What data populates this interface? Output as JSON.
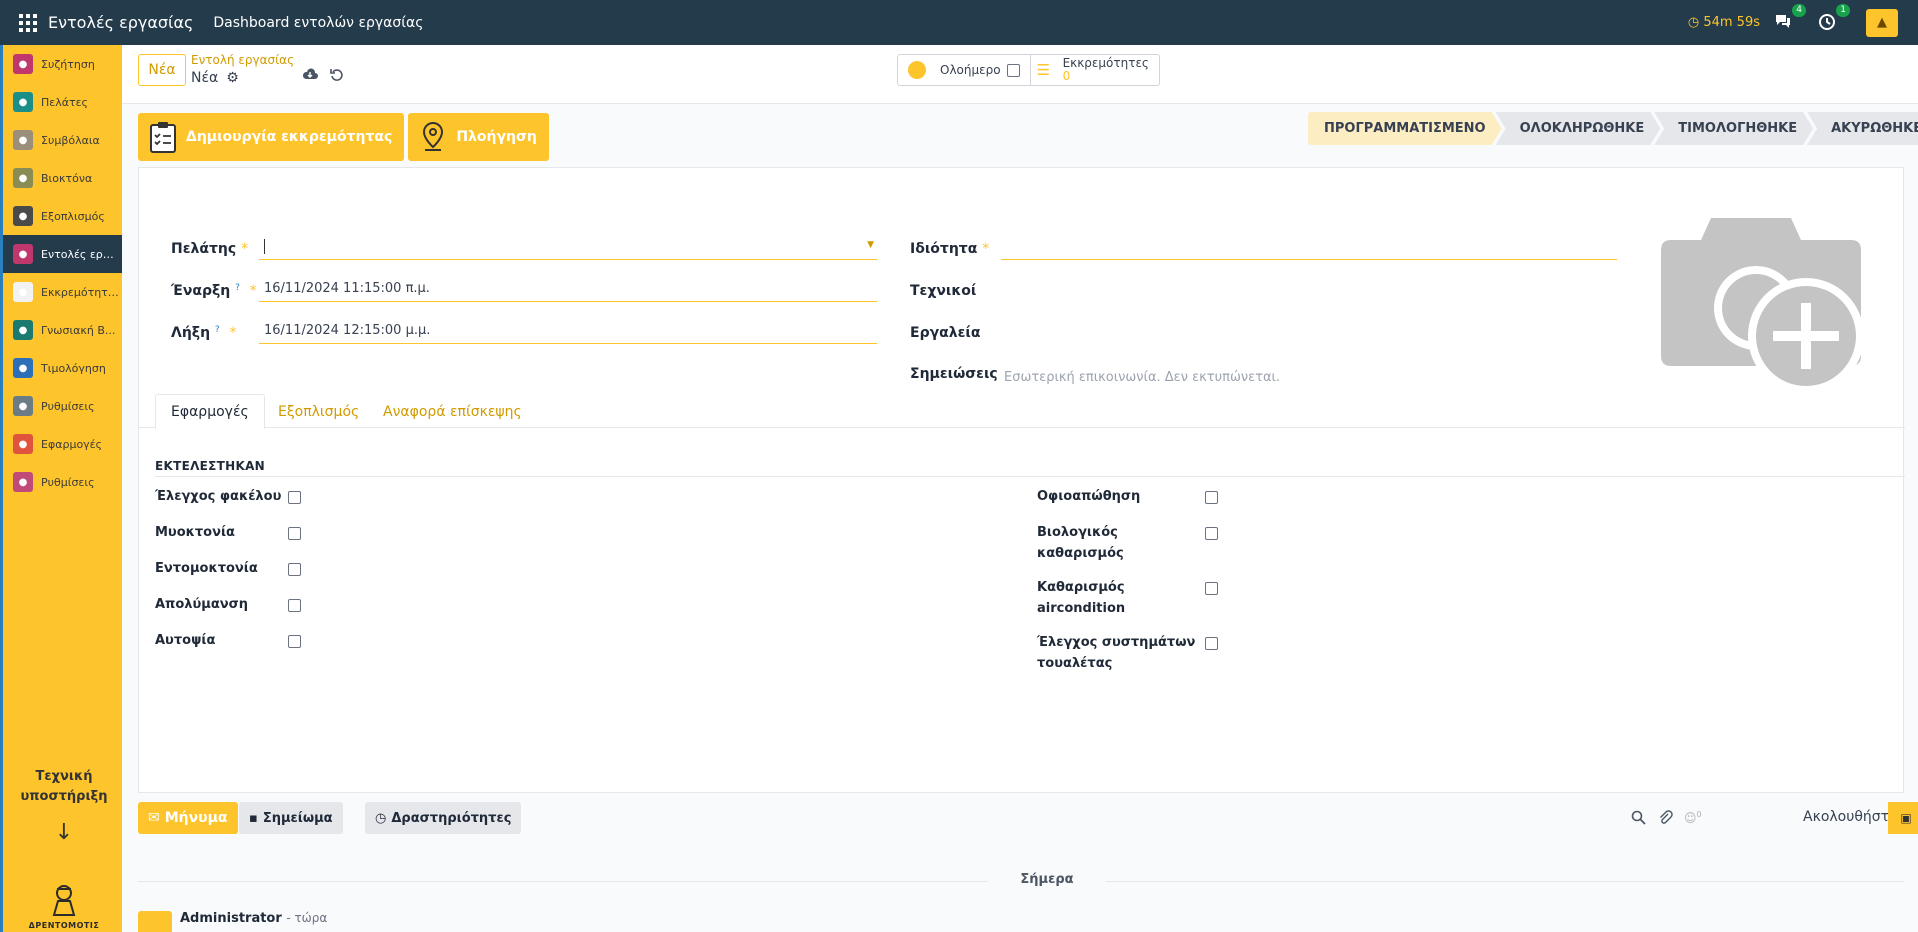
{
  "topbar": {
    "app_title": "Εντολές εργασίας",
    "menu_link": "Dashboard εντολών εργασίας",
    "timer": "54m 59s",
    "messages_count": "4",
    "activities_count": "1"
  },
  "sidebar": {
    "items": [
      {
        "label": "Συζήτηση",
        "icon": "chat-icon",
        "color": "#c0376e"
      },
      {
        "label": "Πελάτες",
        "icon": "customers-icon",
        "color": "#1a8f8a"
      },
      {
        "label": "Συμβόλαια",
        "icon": "contracts-icon",
        "color": "#9a8f7a"
      },
      {
        "label": "Βιοκτόνα",
        "icon": "biocides-icon",
        "color": "#8a8c55"
      },
      {
        "label": "Εξοπλισμός",
        "icon": "equipment-icon",
        "color": "#4a4a4a"
      },
      {
        "label": "Εντολές εργ...",
        "icon": "work-orders-icon",
        "color": "#c0376e"
      },
      {
        "label": "Εκκρεμότητες",
        "icon": "pending-icon",
        "color": "#f2f2f2"
      },
      {
        "label": "Γνωσιακή Β...",
        "icon": "knowledge-icon",
        "color": "#1a7a70"
      },
      {
        "label": "Τιμολόγηση",
        "icon": "invoicing-icon",
        "color": "#2a6fb8"
      },
      {
        "label": "Ρυθμίσεις",
        "icon": "settings-icon",
        "color": "#6b7c86"
      },
      {
        "label": "Εφαρμογές",
        "icon": "apps-icon",
        "color": "#e0533d"
      },
      {
        "label": "Ρυθμίσεις",
        "icon": "settings-icon",
        "color": "#c04a7a"
      }
    ],
    "support_line1": "Τεχνική",
    "support_line2": "υποστήριξη",
    "arrow": "↓",
    "logo_text": "ΔΡΕΝΤΟΜΟΤΙΣ"
  },
  "control_panel": {
    "new_label": "Νέα",
    "breadcrumb_parent": "Εντολή εργασίας",
    "breadcrumb_current": "Νέα",
    "all_day_label": "Ολοήμερο",
    "pending_label": "Εκκρεμότητες",
    "pending_count": "0"
  },
  "actions": {
    "create_pending": "Δημιουργία εκκρεμότητας",
    "navigate": "Πλοήγηση"
  },
  "status_stages": [
    "ΠΡΟΓΡΑΜΜΑΤΙΣΜΕΝΟ",
    "ΟΛΟΚΛΗΡΩΘΗΚΕ",
    "ΤΙΜΟΛΟΓΗΘΗΚΕ",
    "ΑΚΥΡΩΘΗΚΕ"
  ],
  "form": {
    "customer_label": "Πελάτης",
    "start_label": "Έναρξη",
    "start_value": "16/11/2024 11:15:00 π.μ.",
    "end_label": "Λήξη",
    "end_value": "16/11/2024 12:15:00 μ.μ.",
    "property_label": "Ιδιότητα",
    "technicians_label": "Τεχνικοί",
    "tools_label": "Εργαλεία",
    "notes_label": "Σημειώσεις",
    "notes_placeholder": "Εσωτερική επικοινωνία. Δεν εκτυπώνεται.",
    "required_mark": "*",
    "help_mark": "?"
  },
  "tabs": [
    "Εφαρμογές",
    "Εξοπλισμός",
    "Αναφορά επίσκεψης"
  ],
  "section_title": "ΕΚΤΕΛΕΣΤΗΚΑΝ",
  "checks_left": [
    "Έλεγχος φακέλου",
    "Μυοκτονία",
    "Εντομοκτονία",
    "Απολύμανση",
    "Αυτοψία"
  ],
  "checks_right": [
    {
      "line1": "Οφιοαπώθηση",
      "line2": ""
    },
    {
      "line1": "Βιολογικός",
      "line2": "καθαρισμός"
    },
    {
      "line1": "Καθαρισμός",
      "line2": "aircondition"
    },
    {
      "line1": "Έλεγχος συστημάτων",
      "line2": "τουαλέτας"
    }
  ],
  "chatter": {
    "message": "Μήνυμα",
    "note": "Σημείωμα",
    "activities": "Δραστηριότητες",
    "followers_count": "0",
    "follow": "Ακολουθήστε",
    "today": "Σήμερα",
    "author": "Administrator",
    "time": "- τώρα"
  },
  "colors": {
    "accent": "#fdc42b",
    "topbar": "#243b4c"
  }
}
